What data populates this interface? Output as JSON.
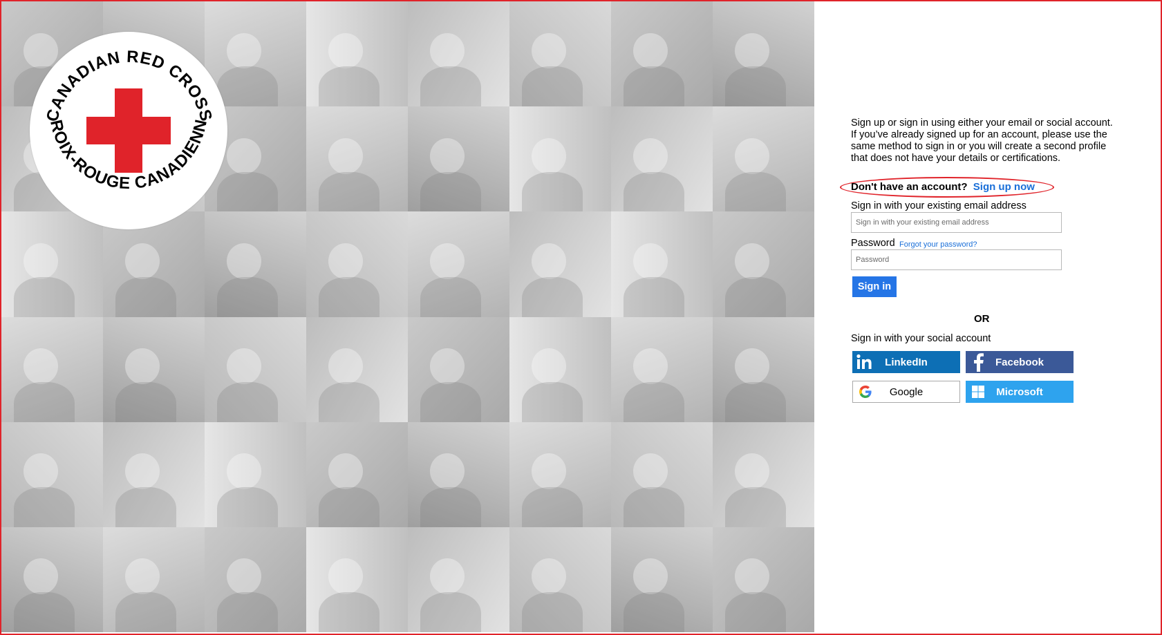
{
  "brand": {
    "logo_top_text": "CANADIAN RED CROSS",
    "logo_bottom_text": "CROIX-ROUGE CANADIENNE",
    "red": "#e0232a",
    "link_blue": "#1a6fd8"
  },
  "intro_text": "Sign up or sign in using either your email or social account. If you’ve already signed up for an account, please use the same method to sign in or you will create a second profile that does not have your details or certifications.",
  "signup": {
    "prompt": "Don't have an account?",
    "link": "Sign up now"
  },
  "email": {
    "label": "Sign in with your existing email address",
    "placeholder": "Sign in with your existing email address"
  },
  "password": {
    "label": "Password",
    "forgot": "Forgot your password?",
    "placeholder": "Password"
  },
  "signin_button": "Sign in",
  "or_text": "OR",
  "social": {
    "label": "Sign in with your social account",
    "buttons": [
      {
        "label": "LinkedIn",
        "icon": "linkedin-icon",
        "color": "#0d6fb5"
      },
      {
        "label": "Facebook",
        "icon": "facebook-icon",
        "color": "#3b5998"
      },
      {
        "label": "Google",
        "icon": "google-icon",
        "color": "#ffffff"
      },
      {
        "label": "Microsoft",
        "icon": "microsoft-icon",
        "color": "#2ea3ee"
      }
    ]
  }
}
